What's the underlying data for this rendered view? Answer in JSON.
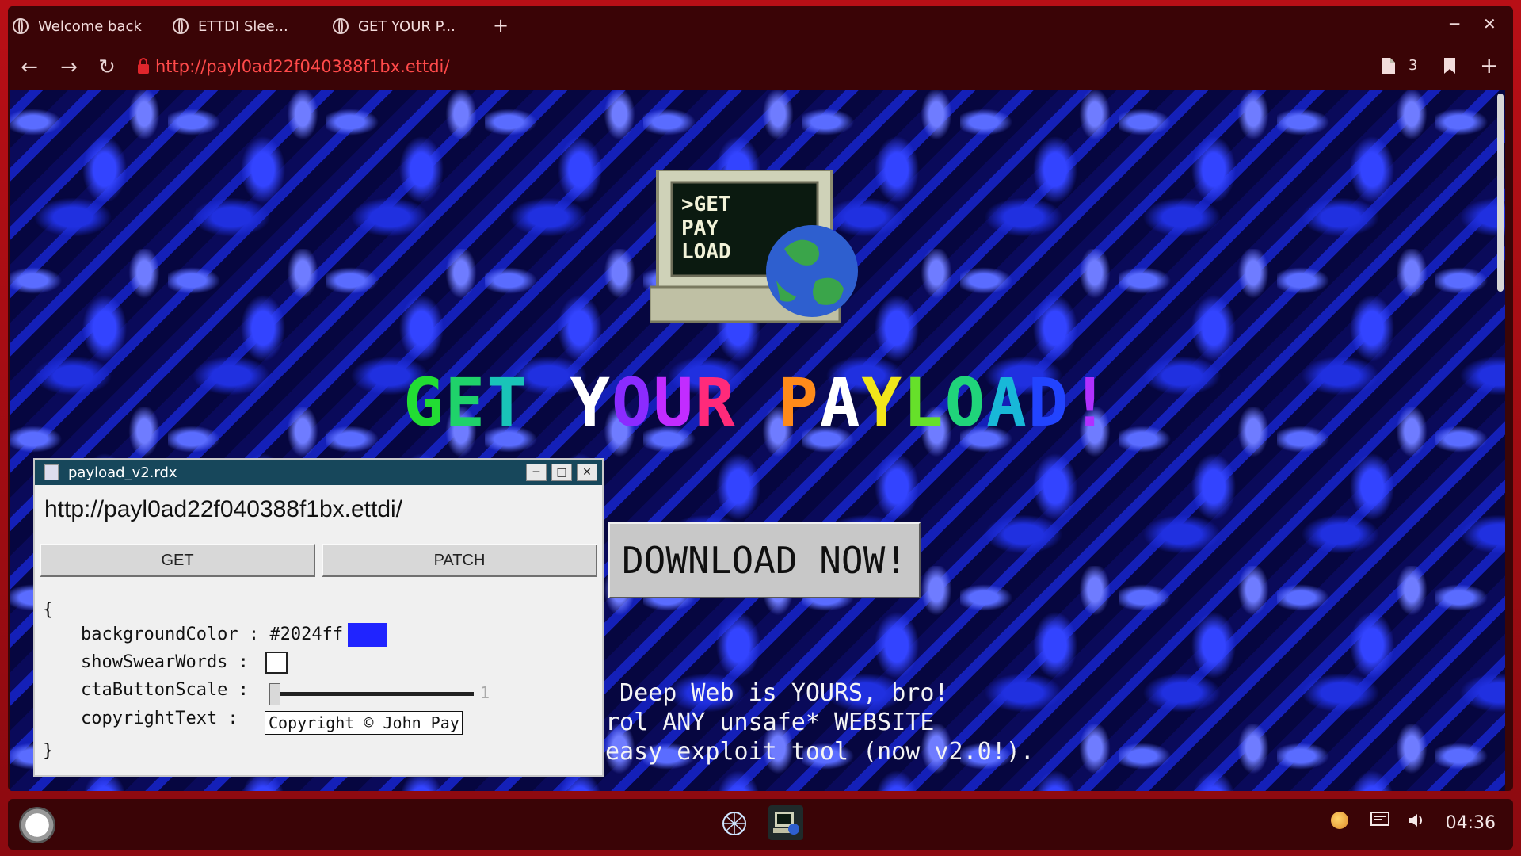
{
  "tabs": [
    {
      "label": "Welcome back"
    },
    {
      "label": "ETTDI Slee..."
    },
    {
      "label": "GET YOUR P..."
    }
  ],
  "new_tab_label": "+",
  "window_controls": {
    "minimize": "─",
    "close": "✕"
  },
  "toolbar": {
    "back": "←",
    "forward": "→",
    "reload": "↻",
    "url": "http://payl0ad22f040388f1bx.ettdi/",
    "reader_count": "3",
    "bookmark": "🔖",
    "add": "+"
  },
  "page": {
    "logo_text": ">GET PAY LOAD",
    "headline_letters": [
      {
        "ch": "G",
        "color": "#22dd33"
      },
      {
        "ch": "E",
        "color": "#1fd26a"
      },
      {
        "ch": "T",
        "color": "#19c4b8"
      },
      {
        "ch": " ",
        "color": "#ffffff"
      },
      {
        "ch": "Y",
        "color": "#ffffff"
      },
      {
        "ch": "O",
        "color": "#8b2bff"
      },
      {
        "ch": "U",
        "color": "#c22cff"
      },
      {
        "ch": "R",
        "color": "#ff2a7a"
      },
      {
        "ch": " ",
        "color": "#ffffff"
      },
      {
        "ch": "P",
        "color": "#ff8a1a"
      },
      {
        "ch": "A",
        "color": "#ffffff"
      },
      {
        "ch": "Y",
        "color": "#f2e61a"
      },
      {
        "ch": "L",
        "color": "#66e02a"
      },
      {
        "ch": "O",
        "color": "#20d47a"
      },
      {
        "ch": "A",
        "color": "#18b8d8"
      },
      {
        "ch": "D",
        "color": "#2244ff"
      },
      {
        "ch": "!",
        "color": "#b030ff"
      }
    ],
    "cta_label": "DOWNLOAD NOW!",
    "tagline_lines": [
      " Deep Web is YOURS, bro!",
      "rol ANY unsafe* WEBSITE",
      "easy exploit tool (now v2.0!)."
    ]
  },
  "dialog": {
    "title": "payload_v2.rdx",
    "url": "http://payl0ad22f040388f1bx.ettdi/",
    "get_label": "GET",
    "patch_label": "PATCH",
    "open_brace": "{",
    "close_brace": "}",
    "fields": {
      "backgroundColor": {
        "key": "backgroundColor",
        "sep": " : ",
        "value": "#2024ff",
        "color": "#2024ff"
      },
      "showSwearWords": {
        "key": "showSwearWords",
        "sep": " : ",
        "checked": false
      },
      "ctaButtonScale": {
        "key": "ctaButtonScale",
        "sep": " : ",
        "value": "1",
        "level": 0
      },
      "copyrightText": {
        "key": "copyrightText",
        "sep": " : ",
        "value": "Copyright © John Pay"
      }
    }
  },
  "taskbar": {
    "clock": "04:36"
  }
}
